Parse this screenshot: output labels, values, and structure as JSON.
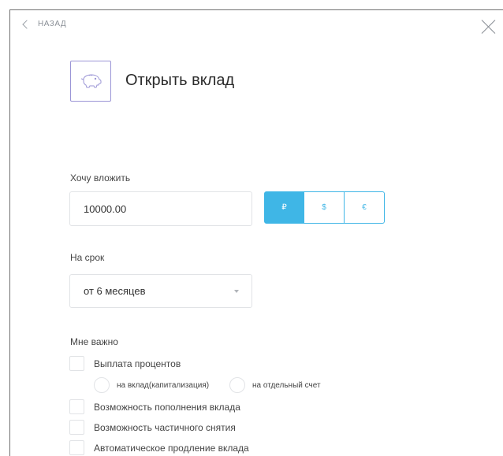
{
  "nav": {
    "back_label": "НАЗАД"
  },
  "header": {
    "title": "Открыть вклад"
  },
  "amount": {
    "label": "Хочу вложить",
    "value": "10000.00"
  },
  "currency": {
    "options": [
      "₽",
      "$",
      "€"
    ],
    "selected": "₽"
  },
  "term": {
    "label": "На срок",
    "selected": "от 6 месяцев"
  },
  "options": {
    "label": "Мне важно",
    "interest_payout": "Выплата процентов",
    "radio_capitalization": "на вклад(капитализация)",
    "radio_separate": "на отдельный счет",
    "replenishment": "Возможность пополнения вклада",
    "partial_withdrawal": "Возможность частичного снятия",
    "auto_renewal": "Автоматическое продление вклада"
  },
  "colors": {
    "accent": "#3fb6e6",
    "icon_border": "#9b95d6"
  }
}
